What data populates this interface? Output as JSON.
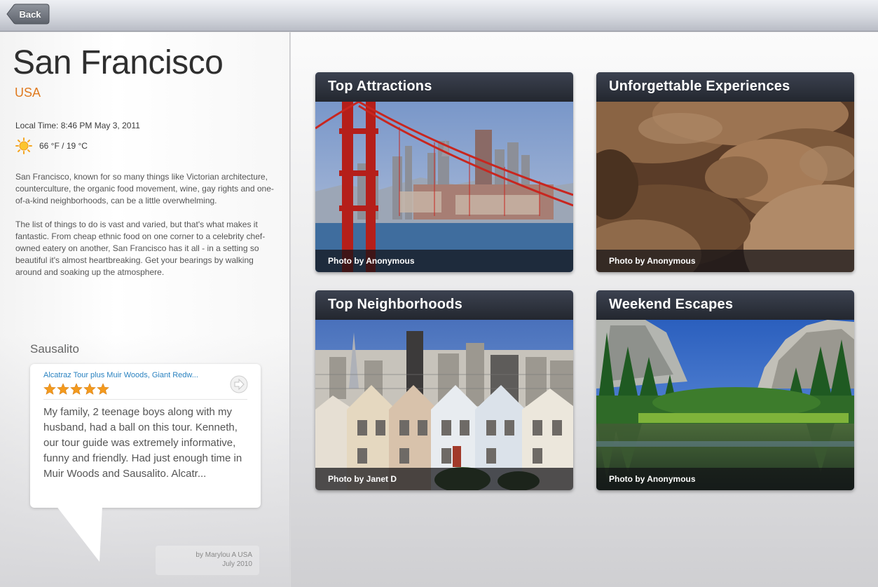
{
  "nav": {
    "back_label": "Back"
  },
  "city": {
    "name": "San Francisco",
    "country": "USA",
    "local_time": "Local Time: 8:46 PM May 3, 2011",
    "weather": "66 °F / 19 °C",
    "weather_icon": "sun-icon",
    "description": [
      "San Francisco, known for so many things like Victorian architecture, counterculture, the organic food movement, wine, gay rights and one-of-a-kind neighborhoods, can be a little overwhelming.",
      "The list of things to do is vast and varied, but that's what makes it fantastic. From cheap ethnic food on one corner to a celebrity chef-owned eatery on another, San Francisco has it all - in a setting so beautiful it's almost heartbreaking. Get your bearings by walking around and soaking up the atmosphere."
    ]
  },
  "review": {
    "place": "Sausalito",
    "title": "Alcatraz Tour plus Muir Woods, Giant Redw...",
    "rating": 5,
    "text": "My family, 2 teenage boys along with my husband, had a ball on this tour. Kenneth, our tour guide was extremely informative, funny and friendly.  Had just enough time in Muir Woods and Sausalito.  Alcatr...",
    "author": "by Marylou A  USA",
    "date": "July 2010"
  },
  "tiles": [
    {
      "title": "Top Attractions",
      "credit": "Photo by Anonymous"
    },
    {
      "title": "Unforgettable Experiences",
      "credit": "Photo by Anonymous"
    },
    {
      "title": "Top Neighborhoods",
      "credit": "Photo by Janet D"
    },
    {
      "title": "Weekend Escapes",
      "credit": "Photo by Anonymous"
    }
  ],
  "colors": {
    "accent_orange": "#e07a1f",
    "link_blue": "#2a82c0",
    "star_orange": "#f39a1e",
    "tile_header": "#2c313b"
  }
}
